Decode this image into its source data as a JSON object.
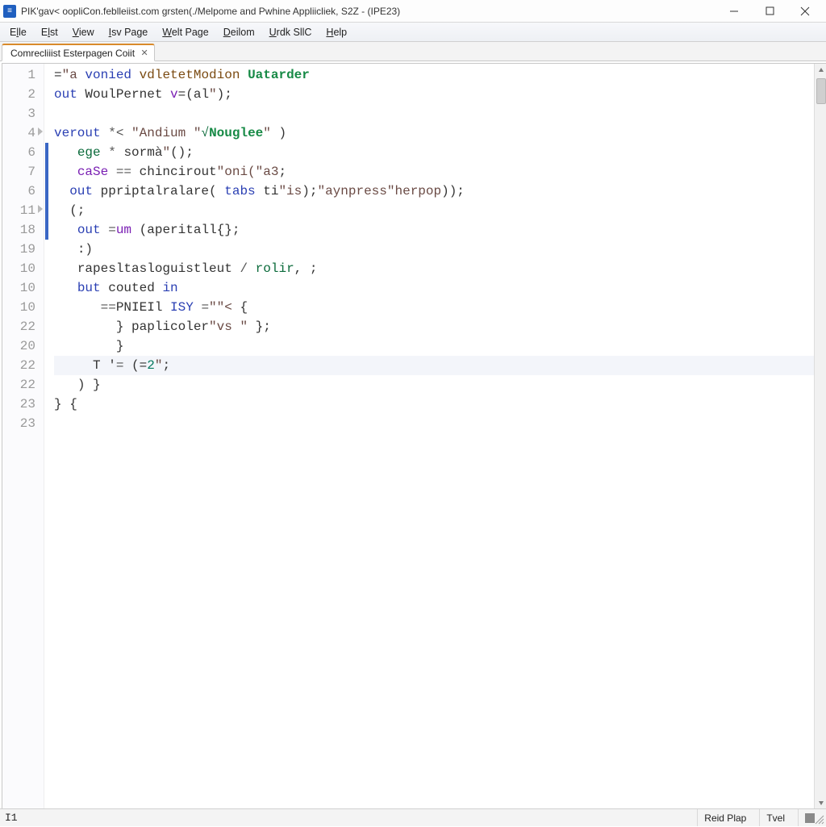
{
  "window": {
    "title": "PIK'gav< oopliCon.feblleiist.com grsten(./Melpome and Pwhine Appliicliek, S2Z - (IPE23)"
  },
  "menu": {
    "items": [
      {
        "pre": "E",
        "ul": "l",
        "post": "le"
      },
      {
        "pre": "E",
        "ul": "l",
        "post": "st"
      },
      {
        "pre": "",
        "ul": "V",
        "post": "iew"
      },
      {
        "pre": "",
        "ul": "I",
        "post": "sv Page"
      },
      {
        "pre": "",
        "ul": "W",
        "post": "elt Page"
      },
      {
        "pre": "",
        "ul": "D",
        "post": "eilom"
      },
      {
        "pre": "",
        "ul": "U",
        "post": "rdk SllC"
      },
      {
        "pre": "",
        "ul": "H",
        "post": "elp"
      }
    ]
  },
  "tab": {
    "label": "Comrecliiist Esterpagen Coiit"
  },
  "gutter": [
    "1",
    "2",
    "3",
    "4",
    "6",
    "7",
    "6",
    "11",
    "18",
    "19",
    "10",
    "10",
    "10",
    "22",
    "20",
    "22",
    "22",
    "23",
    "23"
  ],
  "fold_rows": [
    3,
    7
  ],
  "highlight_row": 15,
  "code_tokens": [
    [
      {
        "c": "pun",
        "t": "="
      },
      {
        "c": "str",
        "t": "\"a "
      },
      {
        "c": "kw",
        "t": "vonied "
      },
      {
        "c": "fn",
        "t": "vdletetModion "
      },
      {
        "c": "hl",
        "t": "Uatarder"
      }
    ],
    [
      {
        "c": "kw",
        "t": "out "
      },
      {
        "c": "id",
        "t": "WoulPernet "
      },
      {
        "c": "kw2",
        "t": "v"
      },
      {
        "c": "pun",
        "t": "=("
      },
      {
        "c": "id",
        "t": "al"
      },
      {
        "c": "str",
        "t": "\""
      },
      {
        "c": "pun",
        "t": ");"
      }
    ],
    [],
    [
      {
        "c": "kw",
        "t": "verout "
      },
      {
        "c": "op",
        "t": "*< "
      },
      {
        "c": "str",
        "t": "\"Andium \""
      },
      {
        "c": "tag",
        "t": "√"
      },
      {
        "c": "hl",
        "t": "Nouglee"
      },
      {
        "c": "str",
        "t": "\" "
      },
      {
        "c": "pun",
        "t": ")"
      }
    ],
    [
      {
        "c": "id",
        "t": "   "
      },
      {
        "c": "tag",
        "t": "ege"
      },
      {
        "c": "op",
        "t": " * "
      },
      {
        "c": "id",
        "t": "sormà"
      },
      {
        "c": "str",
        "t": "\""
      },
      {
        "c": "pun",
        "t": "();"
      }
    ],
    [
      {
        "c": "id",
        "t": "   "
      },
      {
        "c": "kw2",
        "t": "caSe"
      },
      {
        "c": "op",
        "t": " == "
      },
      {
        "c": "id",
        "t": "chincirout"
      },
      {
        "c": "str",
        "t": "\"oni("
      },
      {
        "c": "str",
        "t": "\"a3"
      },
      {
        "c": "pun",
        "t": ";"
      }
    ],
    [
      {
        "c": "id",
        "t": "  "
      },
      {
        "c": "kw",
        "t": "out "
      },
      {
        "c": "id",
        "t": "ppriptalralare"
      },
      {
        "c": "pun",
        "t": "( "
      },
      {
        "c": "kw",
        "t": "tabs "
      },
      {
        "c": "id",
        "t": "ti"
      },
      {
        "c": "str",
        "t": "\"is"
      },
      {
        "c": "pun",
        "t": ");"
      },
      {
        "c": "str",
        "t": "\"aynpress\"herpop"
      },
      {
        "c": "pun",
        "t": "));"
      }
    ],
    [
      {
        "c": "id",
        "t": "  "
      },
      {
        "c": "pun",
        "t": "(;"
      }
    ],
    [
      {
        "c": "id",
        "t": "   "
      },
      {
        "c": "kw",
        "t": "out "
      },
      {
        "c": "op",
        "t": "="
      },
      {
        "c": "kw2",
        "t": "um "
      },
      {
        "c": "pun",
        "t": "("
      },
      {
        "c": "id",
        "t": "aperitall"
      },
      {
        "c": "pun",
        "t": "{};"
      }
    ],
    [
      {
        "c": "id",
        "t": "   "
      },
      {
        "c": "pun",
        "t": ":)"
      }
    ],
    [
      {
        "c": "id",
        "t": "   "
      },
      {
        "c": "id",
        "t": "rapesltasloguistleut "
      },
      {
        "c": "op",
        "t": "/ "
      },
      {
        "c": "tag",
        "t": "rolir"
      },
      {
        "c": "pun",
        "t": ", ;"
      }
    ],
    [
      {
        "c": "id",
        "t": "   "
      },
      {
        "c": "kw",
        "t": "but "
      },
      {
        "c": "id",
        "t": "couted "
      },
      {
        "c": "kw",
        "t": "in"
      }
    ],
    [
      {
        "c": "id",
        "t": "      "
      },
      {
        "c": "op",
        "t": "=="
      },
      {
        "c": "id",
        "t": "PNIEIl "
      },
      {
        "c": "kw",
        "t": "ISY "
      },
      {
        "c": "op",
        "t": "="
      },
      {
        "c": "str",
        "t": "\"\"< "
      },
      {
        "c": "pun",
        "t": "{"
      }
    ],
    [
      {
        "c": "id",
        "t": "        "
      },
      {
        "c": "pun",
        "t": "} "
      },
      {
        "c": "id",
        "t": "paplicoler"
      },
      {
        "c": "str",
        "t": "\"vs \" "
      },
      {
        "c": "pun",
        "t": "};"
      }
    ],
    [
      {
        "c": "id",
        "t": "        "
      },
      {
        "c": "pun",
        "t": "}"
      }
    ],
    [
      {
        "c": "id",
        "t": "     "
      },
      {
        "c": "id",
        "t": "T '"
      },
      {
        "c": "op",
        "t": "= "
      },
      {
        "c": "pun",
        "t": "(="
      },
      {
        "c": "num",
        "t": "2"
      },
      {
        "c": "str",
        "t": "\""
      },
      {
        "c": "pun",
        "t": ";"
      }
    ],
    [
      {
        "c": "id",
        "t": "   "
      },
      {
        "c": "pun",
        "t": ") }"
      }
    ],
    [
      {
        "c": "pun",
        "t": "} {"
      }
    ],
    []
  ],
  "status": {
    "left": "I1",
    "cell1": "Reid Plap",
    "cell2": "Tvel"
  }
}
